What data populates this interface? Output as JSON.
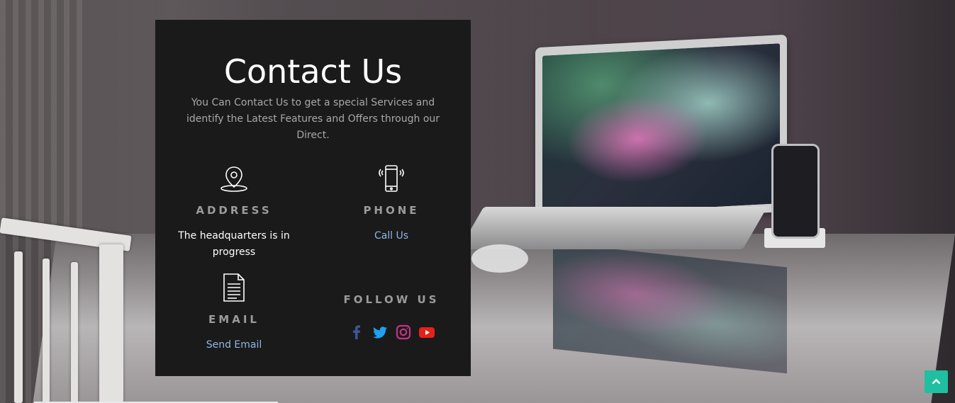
{
  "contact": {
    "title": "Contact Us",
    "subtitle": "You Can Contact Us to get a special Services and identify the Latest Features and Offers through our Direct."
  },
  "address": {
    "icon": "map-pin-icon",
    "label": "ADDRESS",
    "value": "The headquarters is in progress"
  },
  "phone": {
    "icon": "smartphone-ringing-icon",
    "label": "PHONE",
    "link": "Call Us"
  },
  "email": {
    "icon": "document-icon",
    "label": "EMAIL",
    "link": "Send Email"
  },
  "follow": {
    "label": "FOLLOW US",
    "networks": [
      {
        "name": "facebook-icon",
        "color": "#3b5998"
      },
      {
        "name": "twitter-icon",
        "color": "#1da1f2"
      },
      {
        "name": "instagram-icon",
        "color": "#c13584"
      },
      {
        "name": "youtube-icon",
        "color": "#e62117"
      }
    ]
  },
  "colors": {
    "card_bg": "#1a1a1a",
    "link": "#8fb7e6",
    "back_to_top": "#1fbfa0"
  },
  "back_to_top": {
    "icon": "chevron-up-icon"
  }
}
